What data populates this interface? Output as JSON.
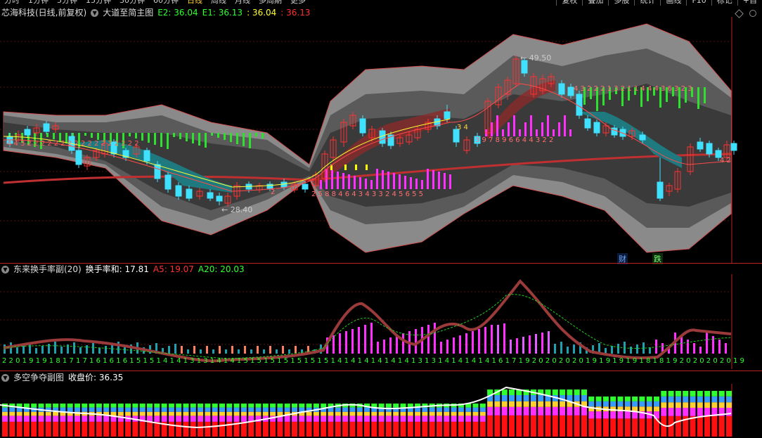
{
  "topbar": {
    "period_tabs": [
      "分时",
      "1分钟",
      "5分钟",
      "15分钟",
      "30分钟",
      "60分钟",
      "日线",
      "周线",
      "月线",
      "多周期",
      "更多"
    ],
    "active_index": 6,
    "right_tabs": [
      "复权",
      "叠加",
      "多股",
      "统计",
      "画线",
      "F10",
      "标记",
      "+自"
    ]
  },
  "main_panel": {
    "title": "芯海科技(日线,前复权)",
    "indicator": "大道至简主图",
    "e2_label": "E2: 36.04",
    "e1_label": "E1: 36.13",
    "val3": ": 36.04",
    "val4": ": 36.13",
    "high_label": "49.50",
    "low_label": "28.40",
    "cai_label": "财",
    "die_label": "跌",
    "digits_left": "4 4 3 2 2 2 2 2 2 2 2 2 2 2 2 2 2 2 2 2",
    "digits_mid": "2 5 8 8 4 6 4 3 4 3 3 2 4 5 6 5 5",
    "digits_right": "3 9 7 8 9 6 6 4 4 3 2 2",
    "digits_top": "4 3 2 2 2 1 3 2 1 1 4 4 4 3 6 3 2 3",
    "digits_end": "4 2",
    "digit_2": "2",
    "digit_34": "3 4"
  },
  "sub1_panel": {
    "title": "东来换手率副(20)",
    "label_main": "换手率和: 17.81",
    "a5": "A5: 19.07",
    "a20": "A20: 20.03",
    "bottom_digits": "2 2 0 1 9 1 9 1 8 1 7 1 7 1 6 1 6 1 6 1 5 1 5 1 4 1 4 1 3 1 3 1 4 1 4 1 5 1 5 1 5 1 5 1 5 1 5 1 5 1 4 1 4 1 4 1 4 1 4 1 4 1 3 1 3 1 4 1 4 1 4 1 4 1 6 1 7 1 9 2 0 2 0 2 0 2 0 1 9 1 9 1 9 1 9 1 8 1 8 1 9 2 0 2 0 2 0 2 0 1 9"
  },
  "sub2_panel": {
    "title": "多空争夺副图",
    "label_close": "收盘价: 36.35"
  },
  "colors": {
    "up": "#ff3030",
    "down": "#40e0ff",
    "band_outer": "#8a8a8a",
    "band_mid": "#5a5a5a",
    "band_inner": "#3a3a3a",
    "green_bar": "#2fe02f",
    "magenta_bar": "#ff30ff",
    "yellow": "#ffff00"
  }
}
